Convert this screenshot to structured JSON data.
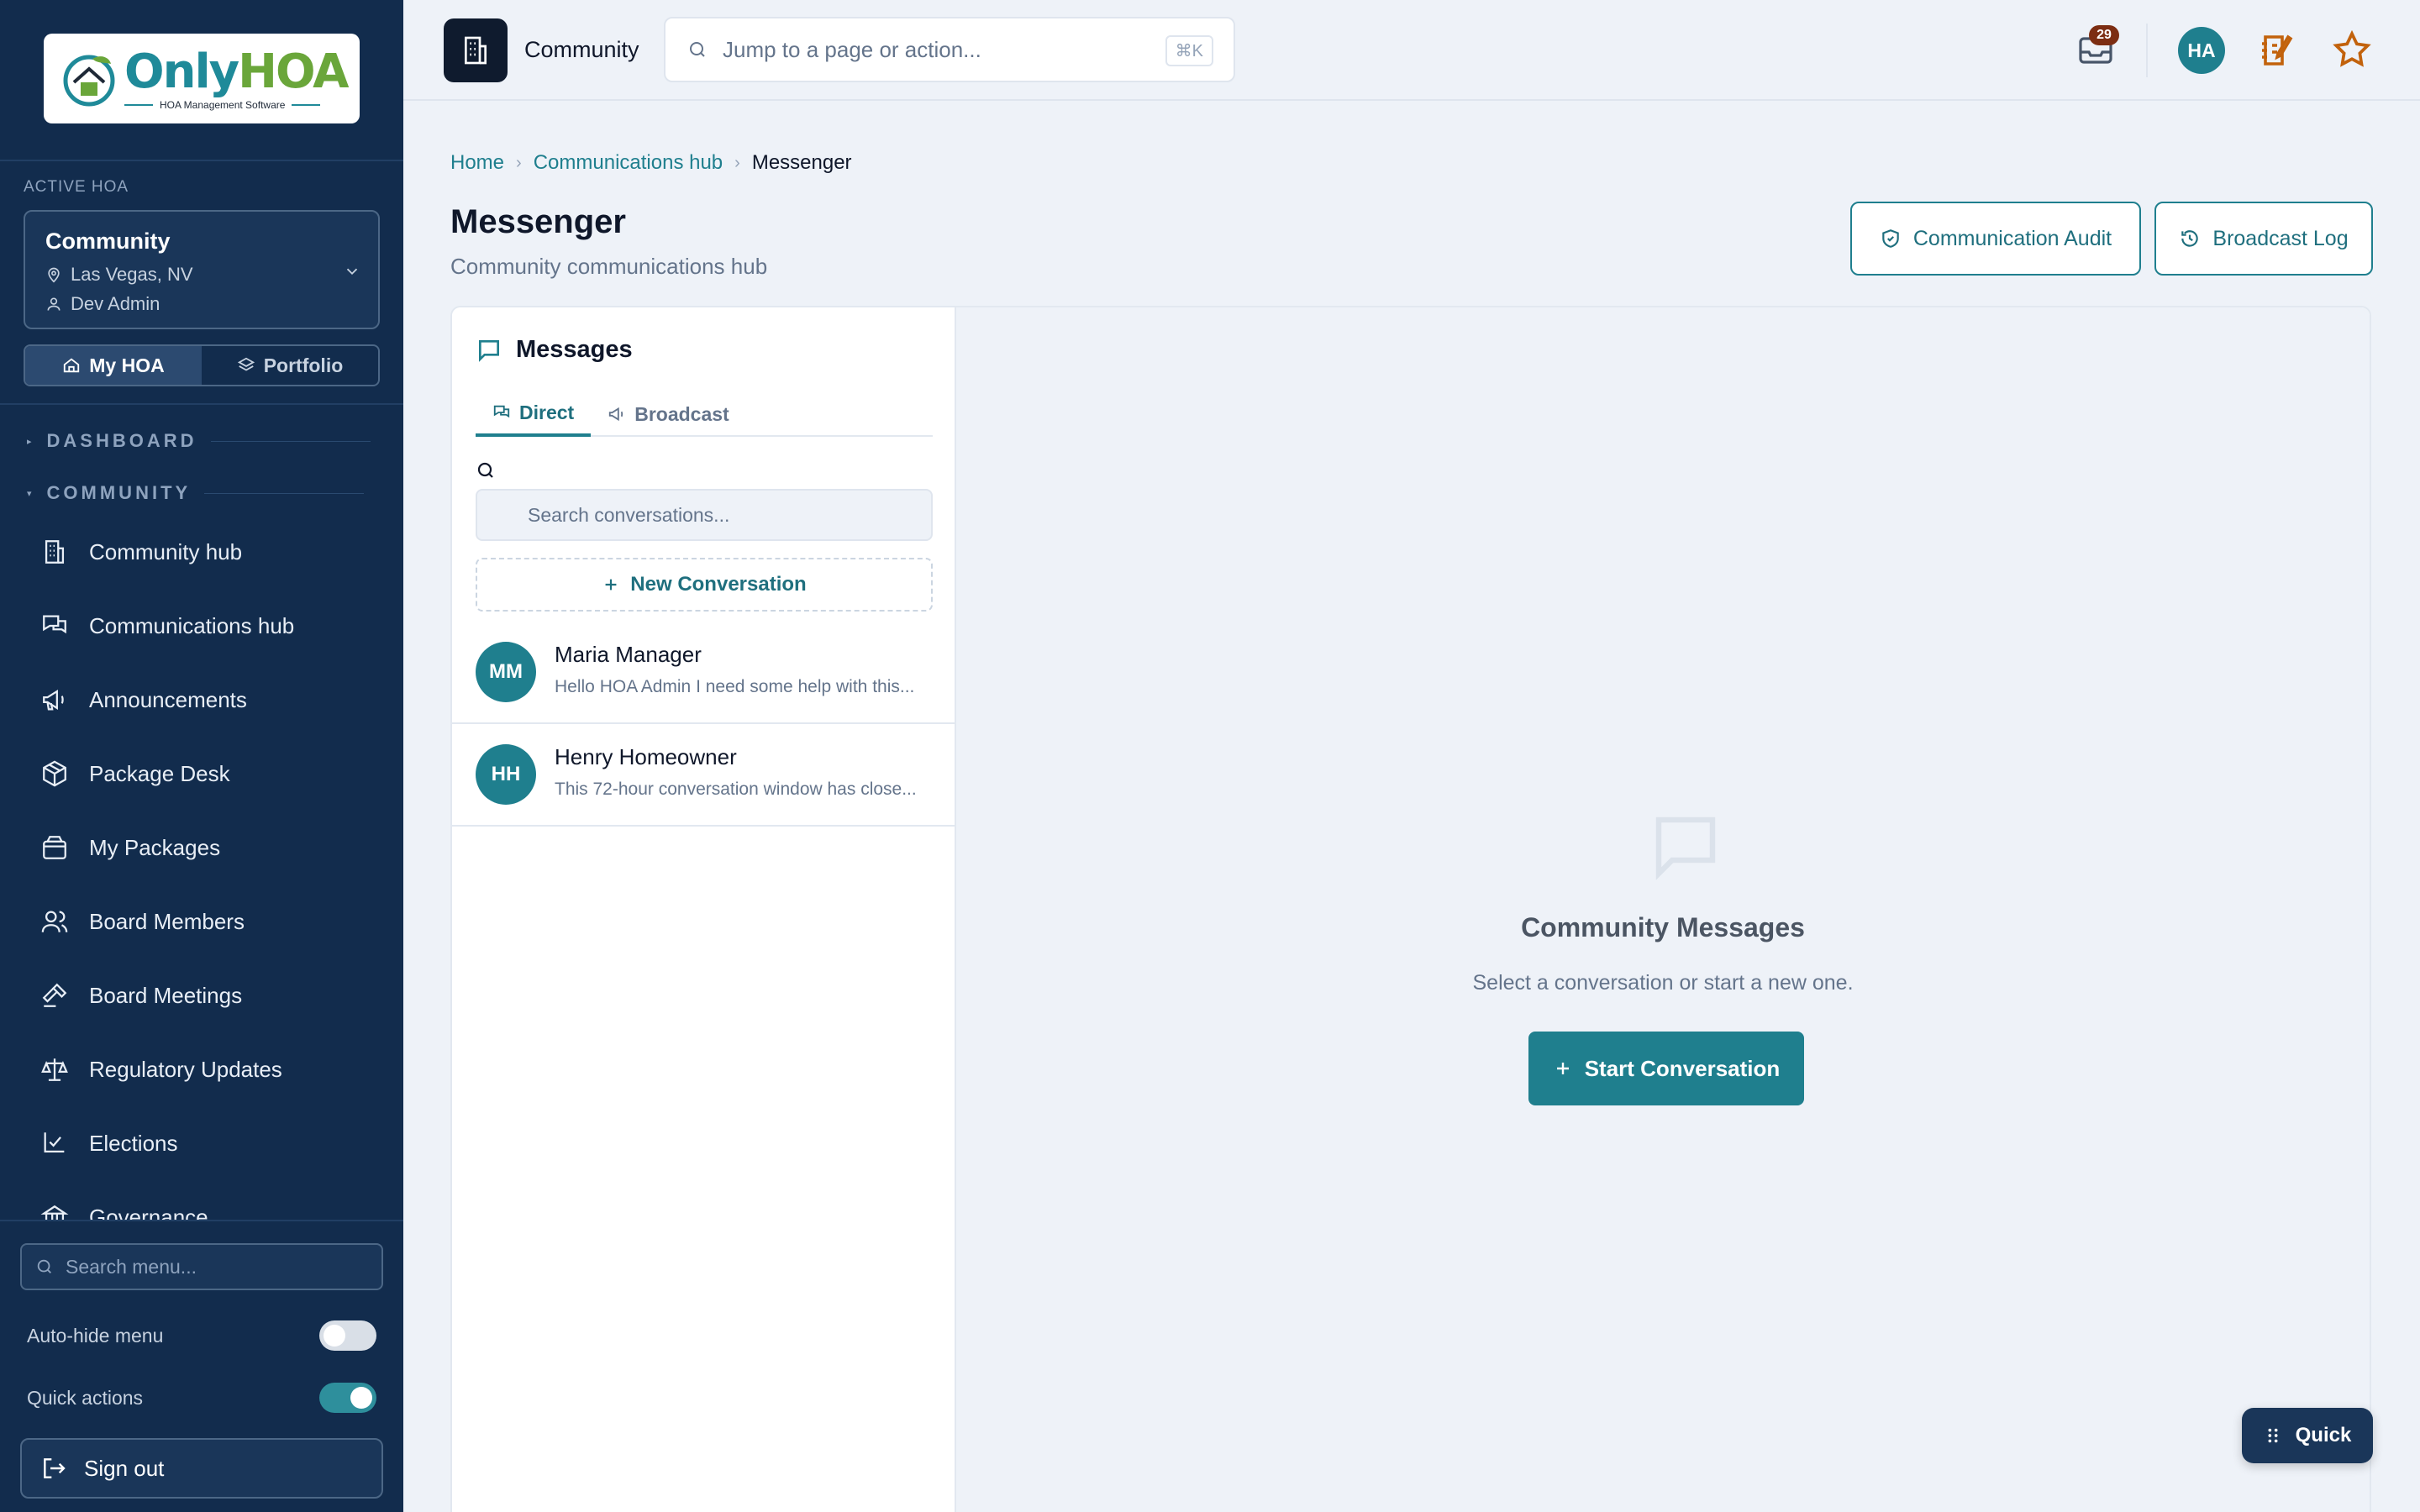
{
  "colors": {
    "sidebar": "#122c4d",
    "accent": "#1f7f8e",
    "page": "#eef2f8",
    "badge": "#7c2d12"
  },
  "logo": {
    "word_a": "Only",
    "word_b": "HOA",
    "tagline": "HOA Management Software"
  },
  "sidebar": {
    "active_label": "ACTIVE HOA",
    "hoa": {
      "name": "Community",
      "location": "Las Vegas, NV",
      "user": "Dev Admin"
    },
    "segments": [
      {
        "label": "My HOA",
        "icon": "home-icon",
        "active": true
      },
      {
        "label": "Portfolio",
        "icon": "layers-icon",
        "active": false
      }
    ],
    "sections": {
      "dashboard": "DASHBOARD",
      "community": "COMMUNITY"
    },
    "items": [
      {
        "label": "Community hub",
        "icon": "building-icon"
      },
      {
        "label": "Communications hub",
        "icon": "chat-icon"
      },
      {
        "label": "Announcements",
        "icon": "megaphone-icon"
      },
      {
        "label": "Package Desk",
        "icon": "package-icon"
      },
      {
        "label": "My Packages",
        "icon": "box-icon"
      },
      {
        "label": "Board Members",
        "icon": "users-icon"
      },
      {
        "label": "Board Meetings",
        "icon": "gavel-icon"
      },
      {
        "label": "Regulatory Updates",
        "icon": "scale-icon"
      },
      {
        "label": "Elections",
        "icon": "ballot-icon"
      },
      {
        "label": "Governance",
        "icon": "bank-icon"
      }
    ],
    "search_placeholder": "Search menu...",
    "toggles": [
      {
        "label": "Auto-hide menu",
        "on": false
      },
      {
        "label": "Quick actions",
        "on": true
      }
    ],
    "signout": "Sign out"
  },
  "topbar": {
    "community": "Community",
    "jump_placeholder": "Jump to a page or action...",
    "shortcut": "⌘K",
    "inbox_count": "29",
    "avatar": "HA"
  },
  "main": {
    "breadcrumbs": [
      "Home",
      "Communications hub",
      "Messenger"
    ],
    "title": "Messenger",
    "subtitle": "Community communications hub",
    "buttons": {
      "audit": "Communication Audit",
      "broadcast_log": "Broadcast Log"
    }
  },
  "messages": {
    "title": "Messages",
    "tabs": [
      {
        "label": "Direct",
        "active": true
      },
      {
        "label": "Broadcast",
        "active": false
      }
    ],
    "search_placeholder": "Search conversations...",
    "new_conversation": "New Conversation",
    "conversations": [
      {
        "initials": "MM",
        "name": "Maria Manager",
        "preview": "Hello HOA Admin I need some help with this..."
      },
      {
        "initials": "HH",
        "name": "Henry Homeowner",
        "preview": "This 72-hour conversation window has close..."
      }
    ]
  },
  "empty": {
    "title": "Community Messages",
    "subtitle": "Select a conversation or start a new one.",
    "button": "Start Conversation"
  },
  "quick": "Quick"
}
